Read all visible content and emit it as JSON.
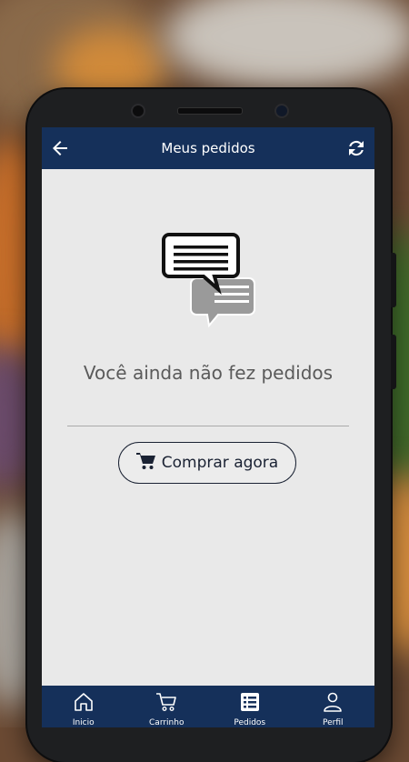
{
  "header": {
    "title": "Meus pedidos",
    "back_icon": "arrow-left-icon",
    "refresh_icon": "refresh-icon"
  },
  "empty_state": {
    "icon": "chat-bubbles-icon",
    "message": "Você ainda não fez pedidos",
    "button_label": "Comprar agora",
    "button_icon": "cart-icon"
  },
  "bottom_nav": {
    "items": [
      {
        "label": "Inicio",
        "icon": "home-icon"
      },
      {
        "label": "Carrinho",
        "icon": "cart-icon"
      },
      {
        "label": "Pedidos",
        "icon": "list-icon"
      },
      {
        "label": "Perfil",
        "icon": "user-icon"
      }
    ]
  },
  "colors": {
    "primary": "#15305a",
    "background": "#e9e9e9",
    "text_muted": "#5a5a5a"
  }
}
